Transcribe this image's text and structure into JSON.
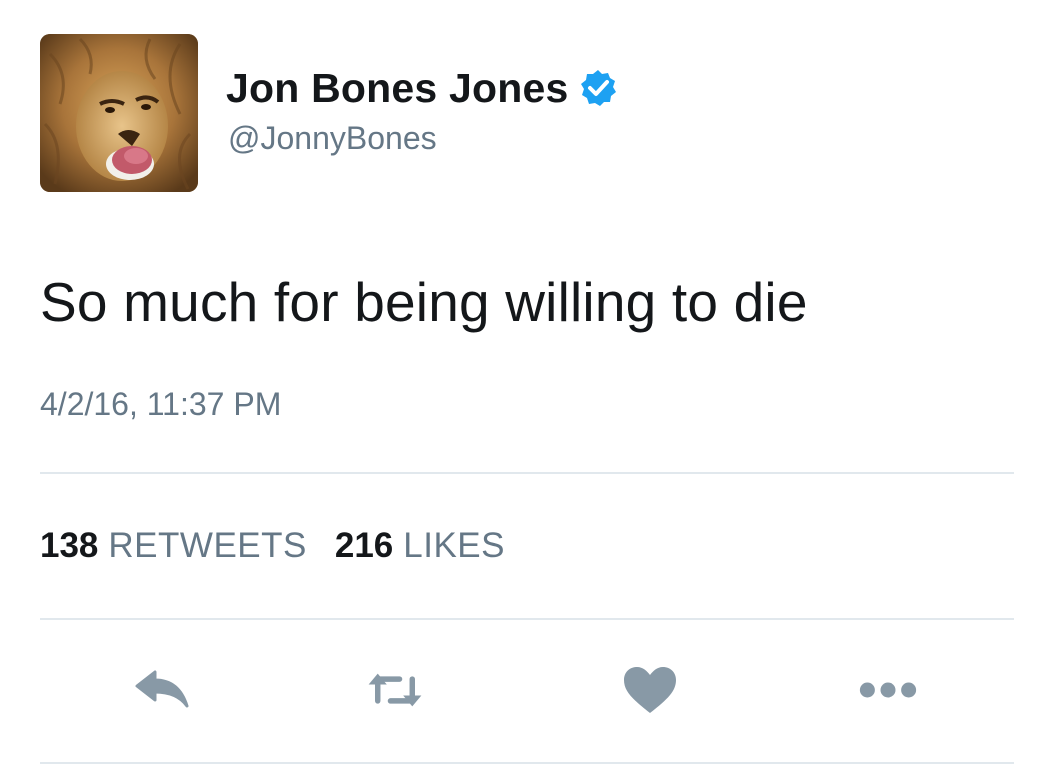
{
  "colors": {
    "text_primary": "#14171a",
    "text_secondary": "#657786",
    "verified_blue": "#1da1f2",
    "action_gray": "#8899a6",
    "divider": "#e1e8ed"
  },
  "author": {
    "display_name": "Jon Bones Jones",
    "handle": "@JonnyBones",
    "verified": true,
    "avatar_icon": "lion-avatar"
  },
  "tweet": {
    "text": "So much for being willing to die",
    "timestamp": "4/2/16, 11:37 PM"
  },
  "stats": {
    "retweets_count": "138",
    "retweets_label": "RETWEETS",
    "likes_count": "216",
    "likes_label": "LIKES"
  },
  "actions": [
    {
      "name": "reply",
      "icon": "reply-icon"
    },
    {
      "name": "retweet",
      "icon": "retweet-icon"
    },
    {
      "name": "like",
      "icon": "heart-icon"
    },
    {
      "name": "more",
      "icon": "more-icon"
    }
  ]
}
